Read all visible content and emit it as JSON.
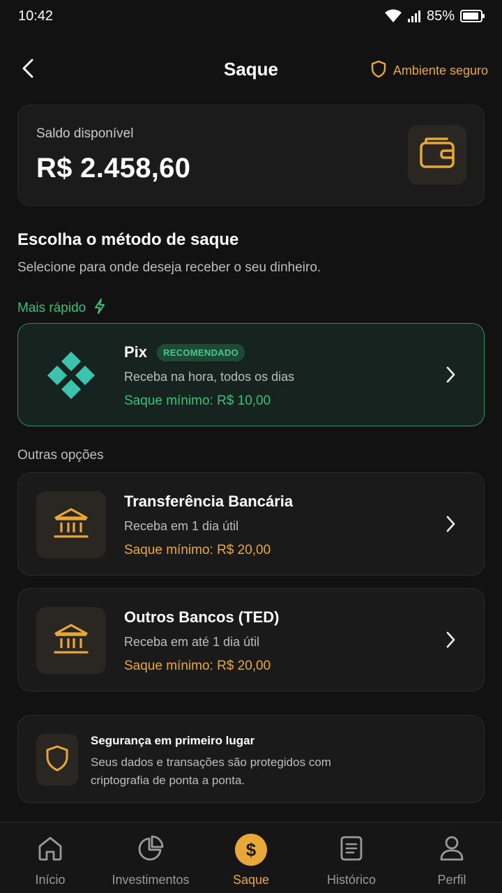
{
  "status_bar": {
    "time": "10:42",
    "battery": "85%"
  },
  "header": {
    "title": "Saque",
    "secure_label": "Ambiente seguro"
  },
  "balance": {
    "label": "Saldo disponível",
    "value": "R$ 2.458,60"
  },
  "section": {
    "title": "Escolha o método de saque",
    "subtitle": "Selecione para onde deseja receber o seu dinheiro.",
    "fast_label": "Mais rápido",
    "other_label": "Outras opções"
  },
  "options": [
    {
      "title": "Pix",
      "badge": "RECOMENDADO",
      "desc": "Receba na hora, todos os dias",
      "min": "Saque mínimo: R$ 10,00"
    },
    {
      "title": "Transferência Bancária",
      "desc": "Receba em 1 dia útil",
      "min": "Saque mínimo: R$ 20,00"
    },
    {
      "title": "Outros Bancos (TED)",
      "desc": "Receba em até 1 dia útil",
      "min": "Saque mínimo: R$ 20,00"
    }
  ],
  "security": {
    "title": "Segurança em primeiro lugar",
    "text": "Seus dados e transações são protegidos com criptografia de ponta a ponta."
  },
  "nav": [
    {
      "label": "Início",
      "icon": "home-icon"
    },
    {
      "label": "Investimentos",
      "icon": "pie-chart-icon"
    },
    {
      "label": "Saque",
      "icon": "dollar-icon",
      "symbol": "$"
    },
    {
      "label": "Histórico",
      "icon": "document-icon"
    },
    {
      "label": "Perfil",
      "icon": "user-icon"
    }
  ],
  "colors": {
    "accent": "#e8a838",
    "green": "#37c07a",
    "background": "#121212"
  }
}
